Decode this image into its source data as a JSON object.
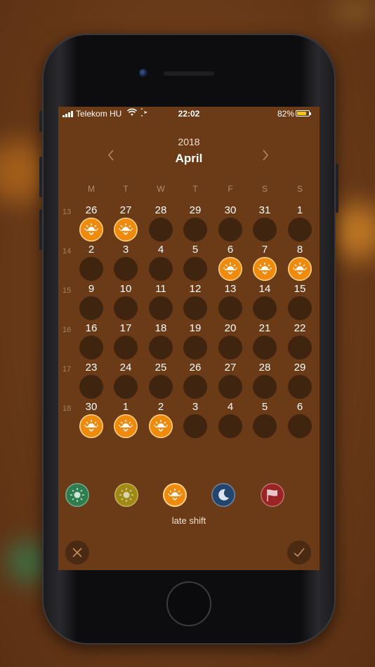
{
  "status_bar": {
    "carrier": "Telekom HU",
    "time": "22:02",
    "battery": "82%",
    "battery_level": 0.82,
    "wifi_icon": "wifi-icon",
    "location_icon": "location-arrow-icon"
  },
  "calendar": {
    "year": "2018",
    "month": "April",
    "prev_icon": "chevron-left-icon",
    "next_icon": "chevron-right-icon",
    "weekdays": [
      "M",
      "T",
      "W",
      "T",
      "F",
      "S",
      "S"
    ],
    "weeks": [
      {
        "number": "13",
        "days": [
          {
            "day": "26",
            "shift": "late"
          },
          {
            "day": "27",
            "shift": "late"
          },
          {
            "day": "28",
            "shift": ""
          },
          {
            "day": "29",
            "shift": ""
          },
          {
            "day": "30",
            "shift": ""
          },
          {
            "day": "31",
            "shift": ""
          },
          {
            "day": "1",
            "shift": ""
          }
        ]
      },
      {
        "number": "14",
        "days": [
          {
            "day": "2",
            "shift": ""
          },
          {
            "day": "3",
            "shift": ""
          },
          {
            "day": "4",
            "shift": ""
          },
          {
            "day": "5",
            "shift": ""
          },
          {
            "day": "6",
            "shift": "late"
          },
          {
            "day": "7",
            "shift": "late"
          },
          {
            "day": "8",
            "shift": "late"
          }
        ]
      },
      {
        "number": "15",
        "days": [
          {
            "day": "9",
            "shift": ""
          },
          {
            "day": "10",
            "shift": ""
          },
          {
            "day": "11",
            "shift": ""
          },
          {
            "day": "12",
            "shift": ""
          },
          {
            "day": "13",
            "shift": ""
          },
          {
            "day": "14",
            "shift": ""
          },
          {
            "day": "15",
            "shift": ""
          }
        ]
      },
      {
        "number": "16",
        "days": [
          {
            "day": "16",
            "shift": ""
          },
          {
            "day": "17",
            "shift": ""
          },
          {
            "day": "18",
            "shift": ""
          },
          {
            "day": "19",
            "shift": ""
          },
          {
            "day": "20",
            "shift": ""
          },
          {
            "day": "21",
            "shift": ""
          },
          {
            "day": "22",
            "shift": ""
          }
        ]
      },
      {
        "number": "17",
        "days": [
          {
            "day": "23",
            "shift": ""
          },
          {
            "day": "24",
            "shift": ""
          },
          {
            "day": "25",
            "shift": ""
          },
          {
            "day": "26",
            "shift": ""
          },
          {
            "day": "27",
            "shift": ""
          },
          {
            "day": "28",
            "shift": ""
          },
          {
            "day": "29",
            "shift": ""
          }
        ]
      },
      {
        "number": "18",
        "days": [
          {
            "day": "30",
            "shift": "late"
          },
          {
            "day": "1",
            "shift": "late"
          },
          {
            "day": "2",
            "shift": "late"
          },
          {
            "day": "3",
            "shift": ""
          },
          {
            "day": "4",
            "shift": ""
          },
          {
            "day": "5",
            "shift": ""
          },
          {
            "day": "6",
            "shift": ""
          }
        ]
      }
    ]
  },
  "shift_types": [
    {
      "name": "early-shift",
      "icon": "sun-icon",
      "color": "#2e7d4f"
    },
    {
      "name": "day-shift",
      "icon": "sun-icon",
      "color": "#a08a14"
    },
    {
      "name": "late-shift",
      "icon": "sunset-icon",
      "color": "#f08a0c"
    },
    {
      "name": "night-shift",
      "icon": "moon-icon",
      "color": "#24456e"
    },
    {
      "name": "day-off",
      "icon": "flag-icon",
      "color": "#9a2424"
    }
  ],
  "selected_shift_label": "late shift",
  "actions": {
    "cancel_icon": "close-icon",
    "confirm_icon": "checkmark-icon"
  },
  "colors": {
    "screen_bg": "#6b3a17",
    "empty_day": "#3f2410",
    "late_shift": "#f08a0c"
  }
}
